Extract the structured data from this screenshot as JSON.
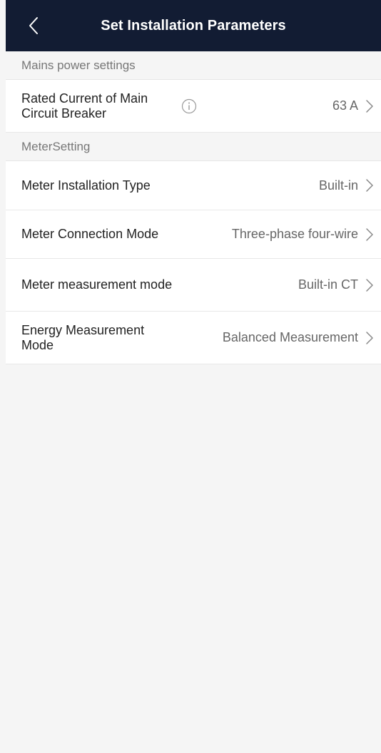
{
  "header": {
    "title": "Set Installation Parameters",
    "back_icon": "chevron-left-icon"
  },
  "sections": {
    "mains": {
      "title": "Mains power settings",
      "rated_current": {
        "label": "Rated Current of Main Circuit Breaker",
        "value": "63 A",
        "info_icon": "info-icon"
      }
    },
    "meter": {
      "title": "MeterSetting",
      "installation_type": {
        "label": "Meter Installation Type",
        "value": "Built-in"
      },
      "connection_mode": {
        "label": "Meter Connection Mode",
        "value": "Three-phase four-wire"
      },
      "measurement_mode": {
        "label": "Meter measurement mode",
        "value": "Built-in CT"
      },
      "energy_measurement": {
        "label": "Energy Measurement Mode",
        "value": "Balanced Measurement"
      }
    }
  },
  "colors": {
    "header_bg": "#121c33",
    "page_bg": "#f5f5f5"
  }
}
